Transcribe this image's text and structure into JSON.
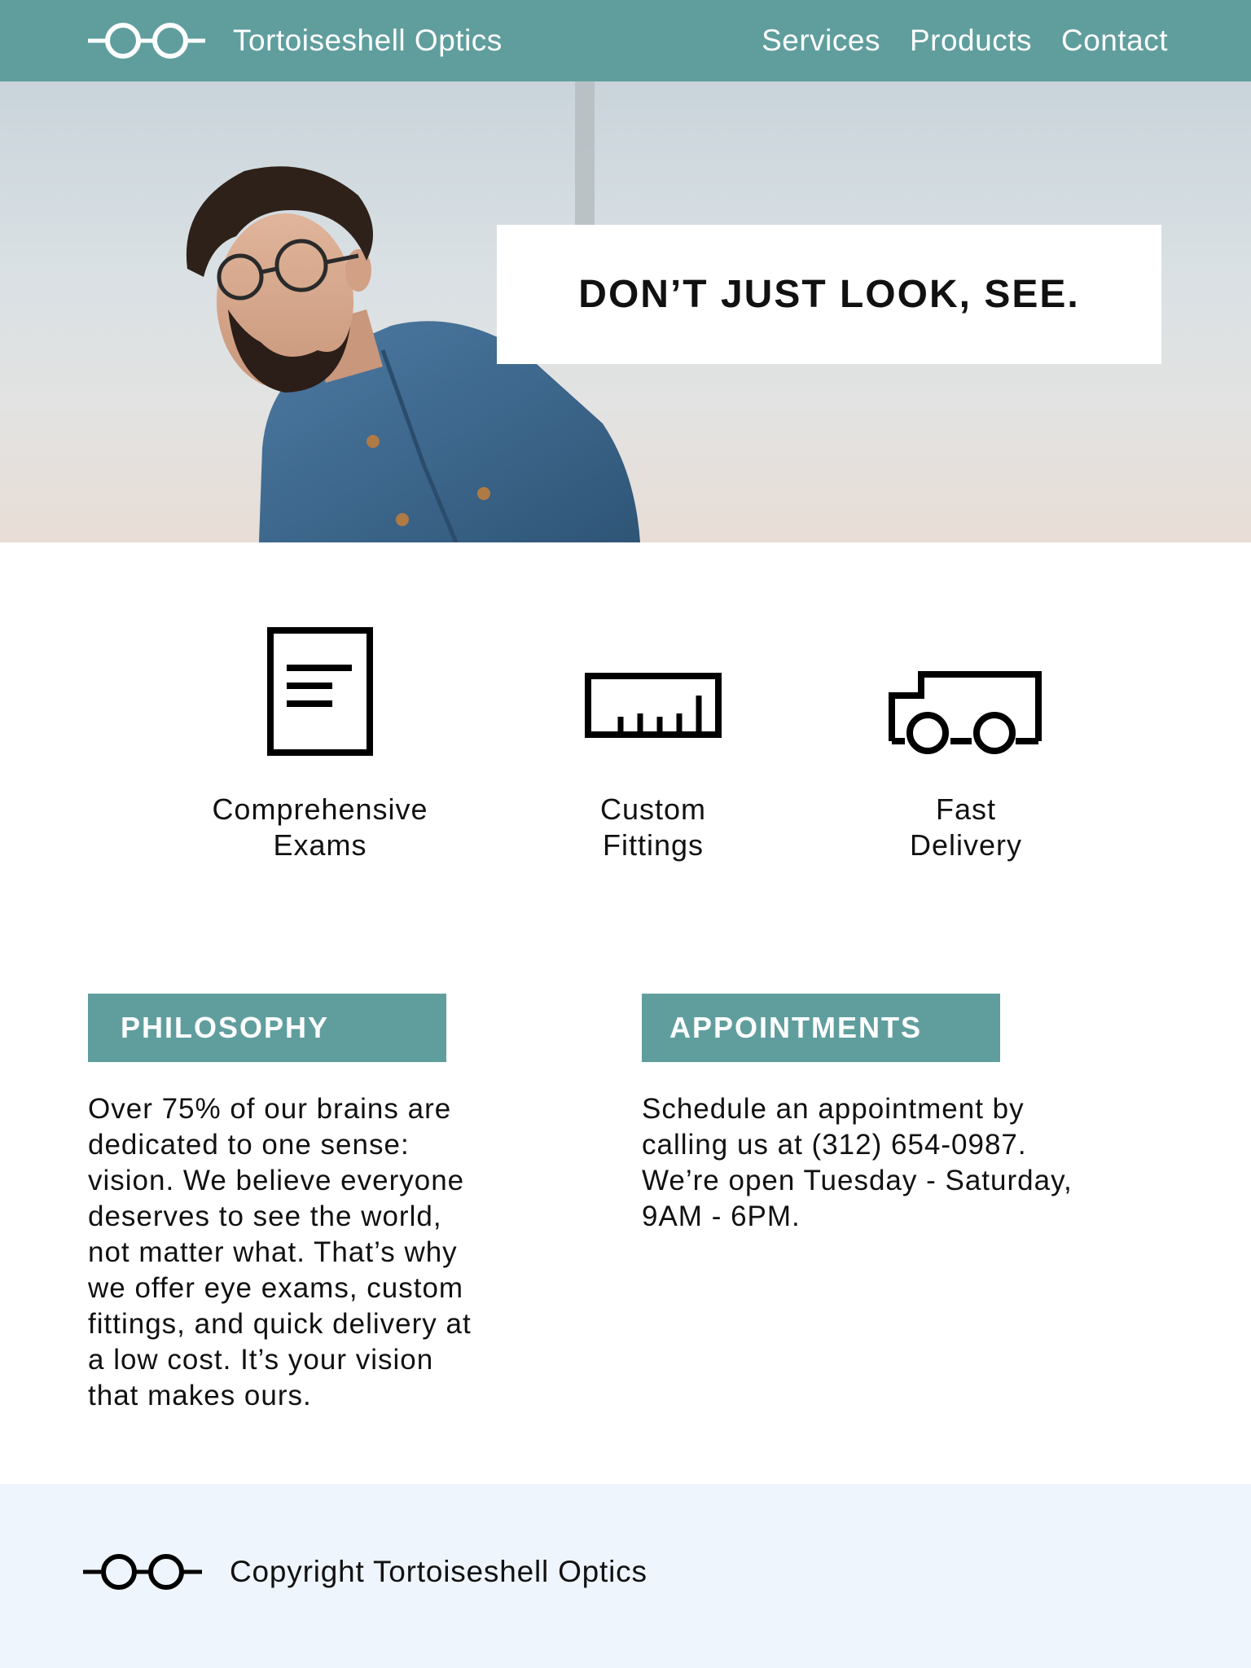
{
  "header": {
    "brand_name": "Tortoiseshell Optics",
    "logo_icon": "glasses-icon",
    "nav": [
      "Services",
      "Products",
      "Contact"
    ]
  },
  "hero": {
    "tagline": "DON’T JUST LOOK, SEE."
  },
  "features": [
    {
      "icon": "document-icon",
      "label_lines": [
        "Comprehensive",
        "Exams"
      ]
    },
    {
      "icon": "ruler-icon",
      "label_lines": [
        "Custom",
        "Fittings"
      ]
    },
    {
      "icon": "truck-icon",
      "label_lines": [
        "Fast",
        "Delivery"
      ]
    }
  ],
  "sections": {
    "philosophy": {
      "title": "PHILOSOPHY",
      "lines": [
        "Over 75% of our brains are",
        "dedicated to one sense:",
        "vision. We believe everyone",
        "deserves to see the world,",
        "not matter what. That’s why",
        "we offer eye exams, custom",
        "fittings, and quick delivery at",
        "a low cost. It’s your vision",
        "that makes ours."
      ]
    },
    "appointments": {
      "title": "APPOINTMENTS",
      "lines": [
        "Schedule an appointment by",
        "calling us at (312) 654-0987.",
        "We’re open Tuesday - Saturday,",
        "9AM - 6PM."
      ]
    }
  },
  "footer": {
    "copyright": "Copyright Tortoiseshell Optics",
    "logo_icon": "glasses-icon"
  },
  "colors": {
    "accent": "#609e9e",
    "footer_bg": "#eef5fd",
    "text": "#111111"
  }
}
